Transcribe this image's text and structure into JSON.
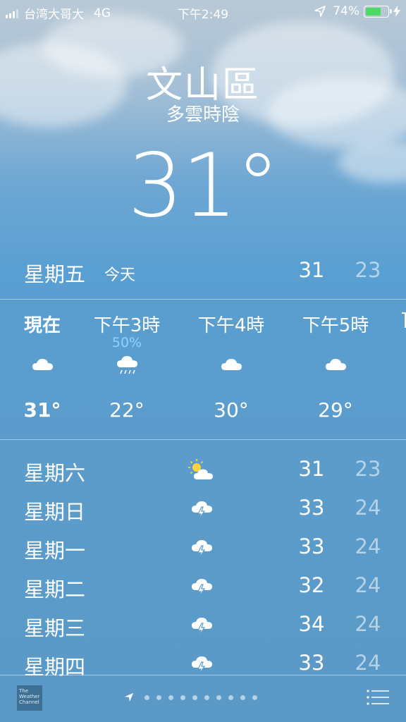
{
  "status_bar": {
    "carrier": "台湾大哥大",
    "network": "4G",
    "time": "下午2:49",
    "battery_percent_label": "74%",
    "battery_level": 0.74,
    "location_icon": "location-arrow-icon",
    "charging_icon": "bolt-icon"
  },
  "location": {
    "city": "文山區",
    "condition": "多雲時陰",
    "temperature": "31°"
  },
  "today": {
    "day": "星期五",
    "tag": "今天",
    "high": "31",
    "low": "23"
  },
  "hourly": [
    {
      "time": "現在",
      "pop": "",
      "icon": "cloud-icon",
      "temp": "31°"
    },
    {
      "time": "下午3時",
      "pop": "50%",
      "icon": "rain-cloud-icon",
      "temp": "22°"
    },
    {
      "time": "下午4時",
      "pop": "",
      "icon": "cloud-icon",
      "temp": "30°"
    },
    {
      "time": "下午5時",
      "pop": "",
      "icon": "cloud-icon",
      "temp": "29°"
    }
  ],
  "daily": [
    {
      "day": "星期六",
      "icon": "partly-sunny-icon",
      "high": "31",
      "low": "23"
    },
    {
      "day": "星期日",
      "icon": "thunderstorm-icon",
      "high": "33",
      "low": "24"
    },
    {
      "day": "星期一",
      "icon": "thunderstorm-icon",
      "high": "33",
      "low": "24"
    },
    {
      "day": "星期二",
      "icon": "thunderstorm-icon",
      "high": "32",
      "low": "24"
    },
    {
      "day": "星期三",
      "icon": "thunderstorm-icon",
      "high": "34",
      "low": "24"
    },
    {
      "day": "星期四",
      "icon": "thunderstorm-icon",
      "high": "33",
      "low": "24"
    }
  ],
  "footer": {
    "logo_text": "The Weather Channel",
    "page_count": 11,
    "list_icon": "list-icon"
  },
  "colors": {
    "battery": "#4cd964",
    "precip": "#8fd3ff"
  }
}
